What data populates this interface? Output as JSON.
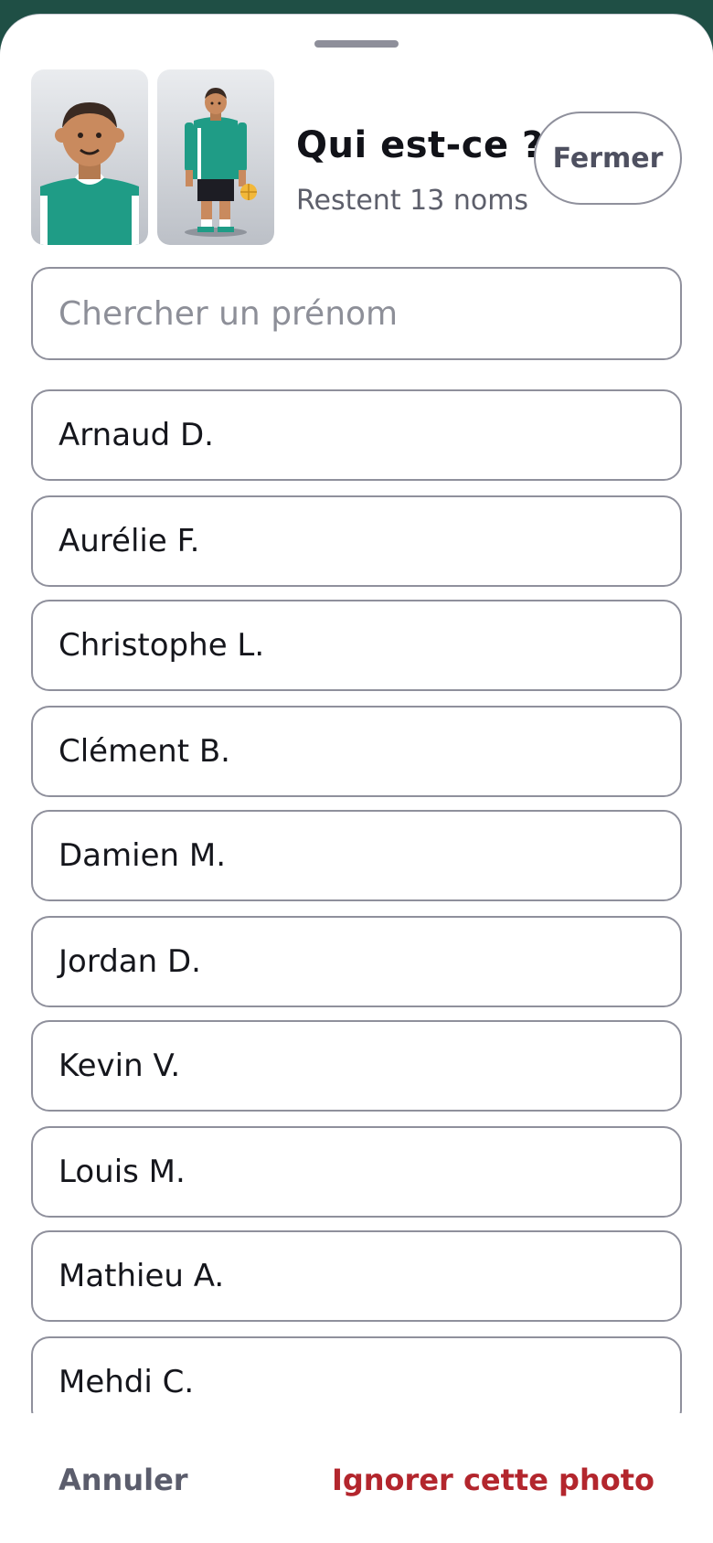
{
  "header": {
    "title": "Qui est-ce ?",
    "subtitle": "Restent 13 noms",
    "close_label": "Fermer"
  },
  "photos": [
    {
      "icon": "portrait-photo"
    },
    {
      "icon": "full-body-photo"
    }
  ],
  "search": {
    "placeholder": "Chercher un prénom",
    "value": ""
  },
  "names": [
    "Arnaud D.",
    "Aurélie F.",
    "Christophe L.",
    "Clément B.",
    "Damien M.",
    "Jordan D.",
    "Kevin V.",
    "Louis M.",
    "Mathieu A.",
    "Mehdi C."
  ],
  "footer": {
    "cancel_label": "Annuler",
    "skip_label": "Ignorer cette photo"
  },
  "colors": {
    "accent_green": "#1f9c86",
    "danger": "#b3262d",
    "border": "#8f909c"
  }
}
